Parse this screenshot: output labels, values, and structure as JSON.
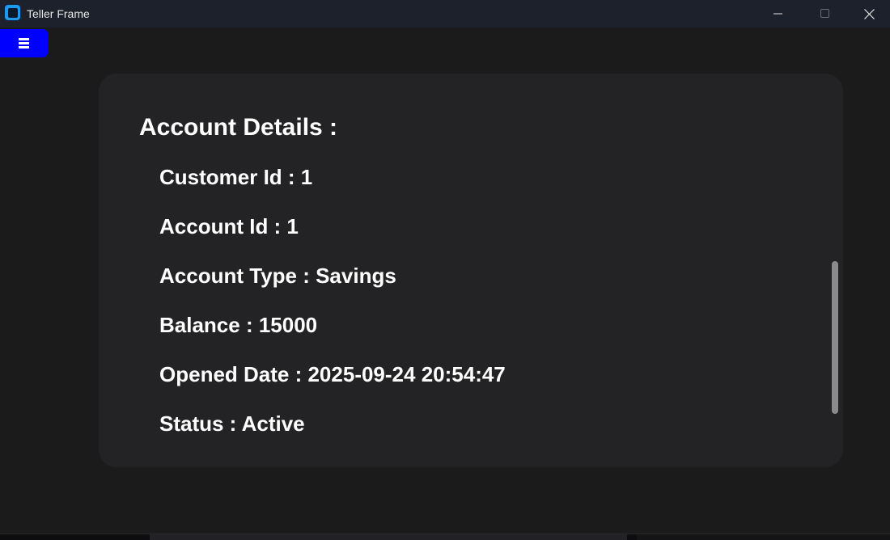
{
  "window": {
    "title": "Teller Frame",
    "app_icon": "app-icon",
    "controls": {
      "minimize_icon": "minimize-icon",
      "maximize_icon": "maximize-icon",
      "close_icon": "close-icon"
    }
  },
  "menu": {
    "icon": "hamburger-menu-icon",
    "color": "#0000ff"
  },
  "account": {
    "heading": "Account Details :",
    "customer_id": "Customer Id : 1",
    "account_id": "Account Id : 1",
    "account_type": "Account Type : Savings",
    "balance": "Balance : 15000",
    "opened_date": "Opened Date : 2025-09-24 20:54:47",
    "status": "Status : Active"
  },
  "colors": {
    "titlebar": "#1d212c",
    "background": "#1b1b1b",
    "card": "#232325",
    "text": "#ffffff",
    "accent_menu": "#0000ff",
    "app_icon": "#1a9bf0"
  }
}
